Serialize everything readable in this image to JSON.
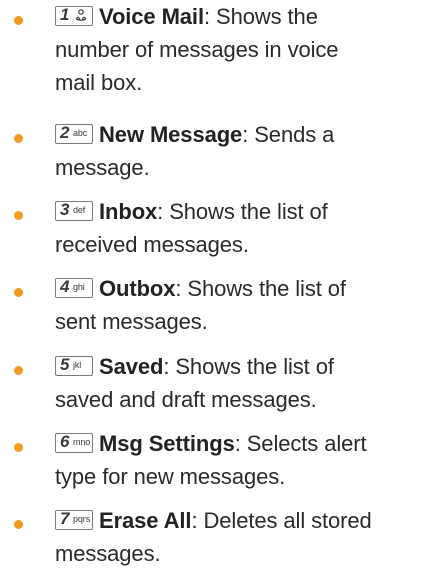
{
  "items": [
    {
      "key_number": "1",
      "key_letters": "",
      "key_icon": "voicemail-icon",
      "title": "Voice Mail",
      "separator": ": ",
      "line1": "Shows the",
      "line2": "number of messages in voice",
      "line3": "mail box."
    },
    {
      "key_number": "2",
      "key_letters": "abc",
      "title": "New Message",
      "separator": ": ",
      "line1": "Sends a",
      "line2": "message.",
      "line3": ""
    },
    {
      "key_number": "3",
      "key_letters": "def",
      "title": "Inbox",
      "separator": ": ",
      "line1": "Shows the list of",
      "line2": "received messages.",
      "line3": ""
    },
    {
      "key_number": "4",
      "key_letters": "ghi",
      "title": "Outbox",
      "separator": ": ",
      "line1": "Shows the list of",
      "line2": "sent messages.",
      "line3": ""
    },
    {
      "key_number": "5",
      "key_letters": "jkl",
      "title": "Saved",
      "separator": ": ",
      "line1": "Shows the list of",
      "line2": "saved and draft messages.",
      "line3": ""
    },
    {
      "key_number": "6",
      "key_letters": "mno",
      "title": "Msg Settings",
      "separator": ": ",
      "line1": "Selects alert",
      "line2": "type for new messages.",
      "line3": ""
    },
    {
      "key_number": "7",
      "key_letters": "pqrs",
      "title": "Erase All",
      "separator": ": ",
      "line1": "Deletes all stored",
      "line2": "messages.",
      "line3": ""
    }
  ],
  "colors": {
    "bullet": "#f39a21",
    "text": "#2a2a2a"
  }
}
